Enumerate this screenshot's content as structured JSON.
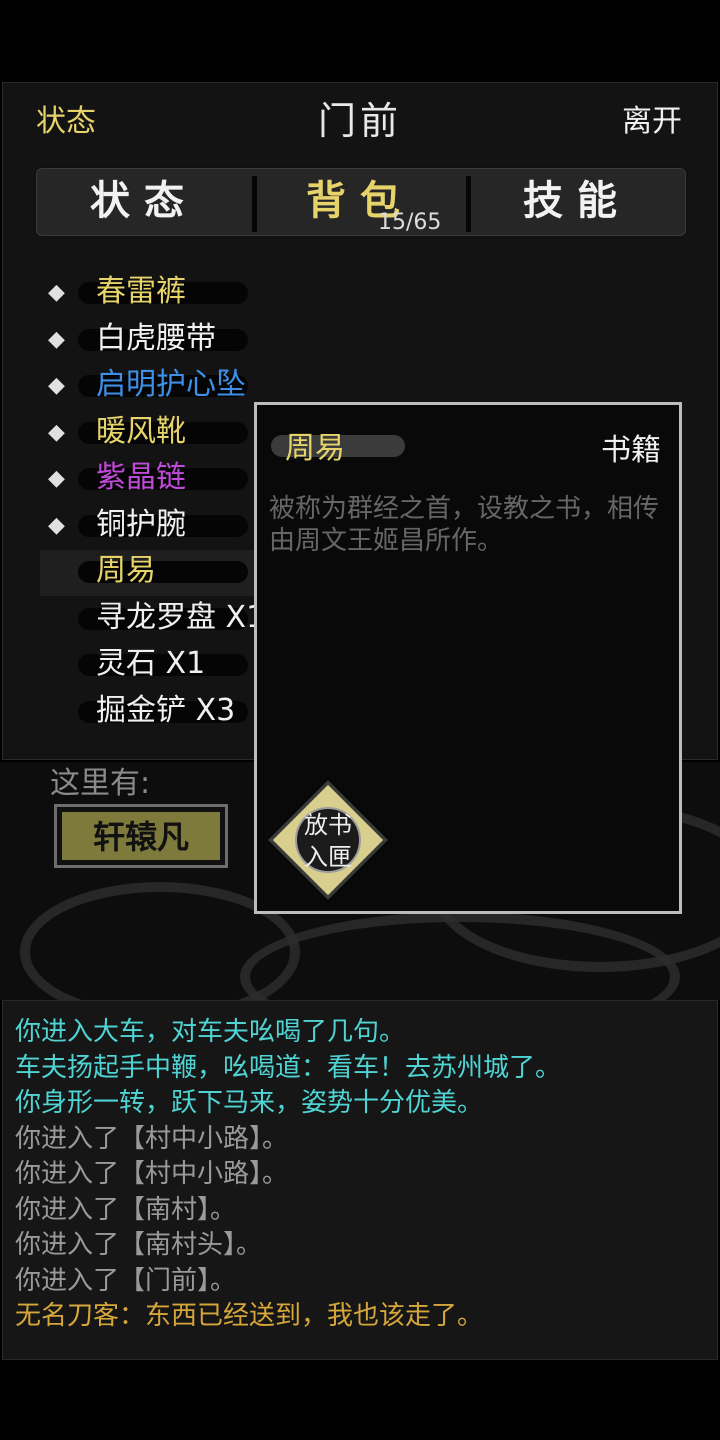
{
  "header": {
    "status_link": "状态",
    "location": "门前",
    "leave_link": "离开"
  },
  "tabs": [
    {
      "label": "状态"
    },
    {
      "label": "背包"
    },
    {
      "label": "技能"
    }
  ],
  "bag": {
    "count": "15/65"
  },
  "inventory": [
    {
      "name": "春雷裤",
      "color": "#e6d36a",
      "equipped": true
    },
    {
      "name": "白虎腰带",
      "color": "#f0f0f0",
      "equipped": true
    },
    {
      "name": "启明护心坠",
      "color": "#3d8fe8",
      "equipped": true
    },
    {
      "name": "暖风靴",
      "color": "#e6d36a",
      "equipped": true
    },
    {
      "name": "紫晶链",
      "color": "#c04ad8",
      "equipped": true
    },
    {
      "name": "铜护腕",
      "color": "#f0f0f0",
      "equipped": true
    },
    {
      "name": "周易",
      "color": "#e6d36a",
      "equipped": false,
      "selected": true
    },
    {
      "name": "寻龙罗盘 X1",
      "color": "#f0f0f0",
      "equipped": false
    },
    {
      "name": "灵石 X1",
      "color": "#f0f0f0",
      "equipped": false
    },
    {
      "name": "掘金铲 X3",
      "color": "#f0f0f0",
      "equipped": false
    }
  ],
  "scene": {
    "here_label": "这里有:",
    "npc": "轩辕凡"
  },
  "popup": {
    "item_name": "周易",
    "item_type": "书籍",
    "description": "被称为群经之首，设教之书，相传由周文王姬昌所作。",
    "action_line1": "放书",
    "action_line2": "入匣"
  },
  "log": [
    {
      "text": "你进入大车，对车夫吆喝了几句。",
      "color": "#4fd3d3"
    },
    {
      "text": "车夫扬起手中鞭，吆喝道：看车！去苏州城了。",
      "color": "#4fd3d3"
    },
    {
      "text": "你身形一转，跃下马来，姿势十分优美。",
      "color": "#4fd3d3"
    },
    {
      "text": "你进入了【村中小路】。",
      "color": "#9a9a9a"
    },
    {
      "text": "你进入了【村中小路】。",
      "color": "#9a9a9a"
    },
    {
      "text": "你进入了【南村】。",
      "color": "#9a9a9a"
    },
    {
      "text": "你进入了【南村头】。",
      "color": "#9a9a9a"
    },
    {
      "text": "你进入了【门前】。",
      "color": "#9a9a9a"
    },
    {
      "text": "无名刀客：东西已经送到，我也该走了。",
      "color": "#d6a63a"
    }
  ]
}
